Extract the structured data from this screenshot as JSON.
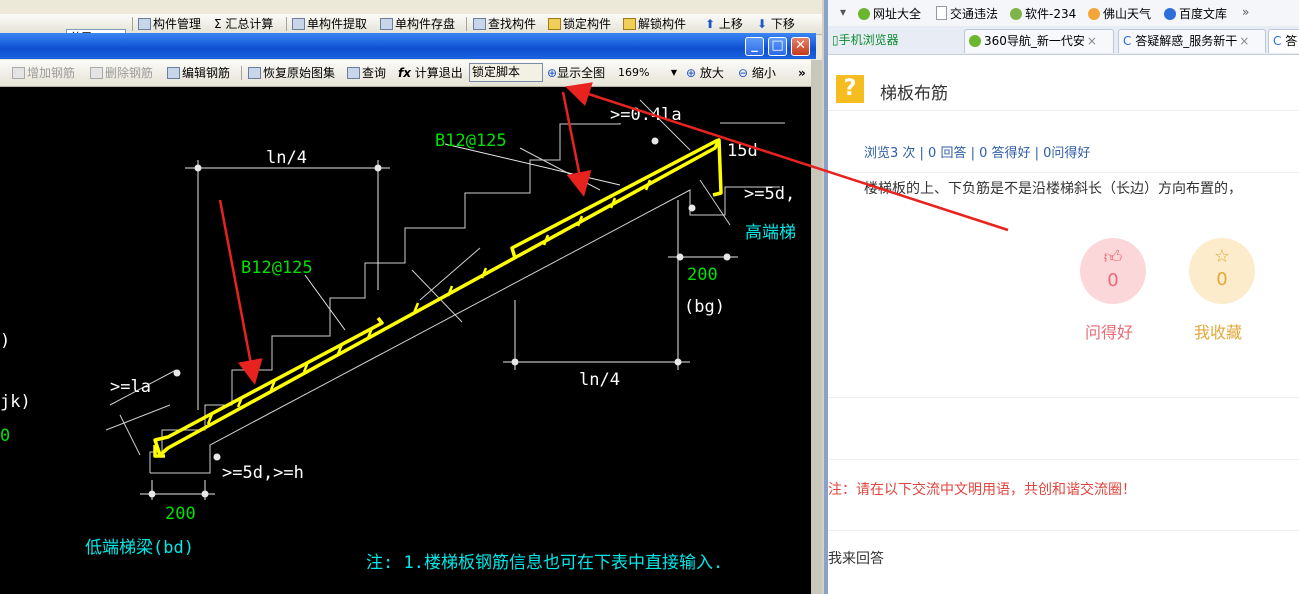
{
  "toolbar": {
    "layer": "首层",
    "items": [
      "构件管理",
      "Σ 汇总计算",
      "单构件提取",
      "单构件存盘",
      "查找构件",
      "锁定构件",
      "解锁构件",
      "上移",
      "下移"
    ]
  },
  "subtoolbar": {
    "add_rebar": "增加钢筋",
    "delete_rebar": "删除钢筋",
    "edit_rebar": "编辑钢筋",
    "restore_atlas": "恢复原始图集",
    "query": "查询",
    "calc_exit": "计算退出",
    "lock_script": "锁定脚本",
    "show_all": "显示全图",
    "zoom_value": "169%",
    "zoom_in": "放大",
    "zoom_out": "缩小"
  },
  "drawing": {
    "top_label_rebar": "B12@125",
    "mid_label_rebar": "B12@125",
    "ln4_top": "ln/4",
    "ln4_bottom": "ln/4",
    "anchor_04la": ">=0.4la",
    "anchor_15d": "15d",
    "anchor_5d_top": ">=5d,",
    "anchor_la": ">=la",
    "anchor_5d_h": ">=5d,>=h",
    "dim_200_top": "200",
    "dim_200_bottom": "200",
    "bg": "(bg)",
    "high_beam": "高端梯",
    "low_beam": "低端梯梁(bd)",
    "left_fragment_1": ")",
    "left_fragment_2": "jk)",
    "left_fragment_3": "0",
    "note": "注: 1.楼梯板钢筋信息也可在下表中直接输入."
  },
  "browser": {
    "bookmarks": [
      "网址大全",
      "交通违法",
      "软件-234",
      "佛山天气",
      "百度文库"
    ],
    "tabs": [
      "手机浏览器",
      "360导航_新一代安",
      "答疑解惑_服务新干",
      "答"
    ],
    "question": {
      "title": "梯板布筋",
      "stats": "浏览3 次 | 0 回答 | 0 答得好 | 0问得好",
      "body": "楼梯板的上、下负筋是不是沿楼梯斜长（长边）方向布置的，",
      "good_count": "0",
      "good_label": "问得好",
      "fav_count": "0",
      "fav_label": "我收藏",
      "notice": "注：请在以下交流中文明用语，共创和谐交流圈！",
      "answer_prompt": "我来回答"
    }
  },
  "colors": {
    "rebar": "#ffff00",
    "dimension_text": "#ffffff",
    "rebar_label": "#00ff00",
    "beam_label": "#00ffff",
    "annotation_arrow": "#e8231f"
  }
}
